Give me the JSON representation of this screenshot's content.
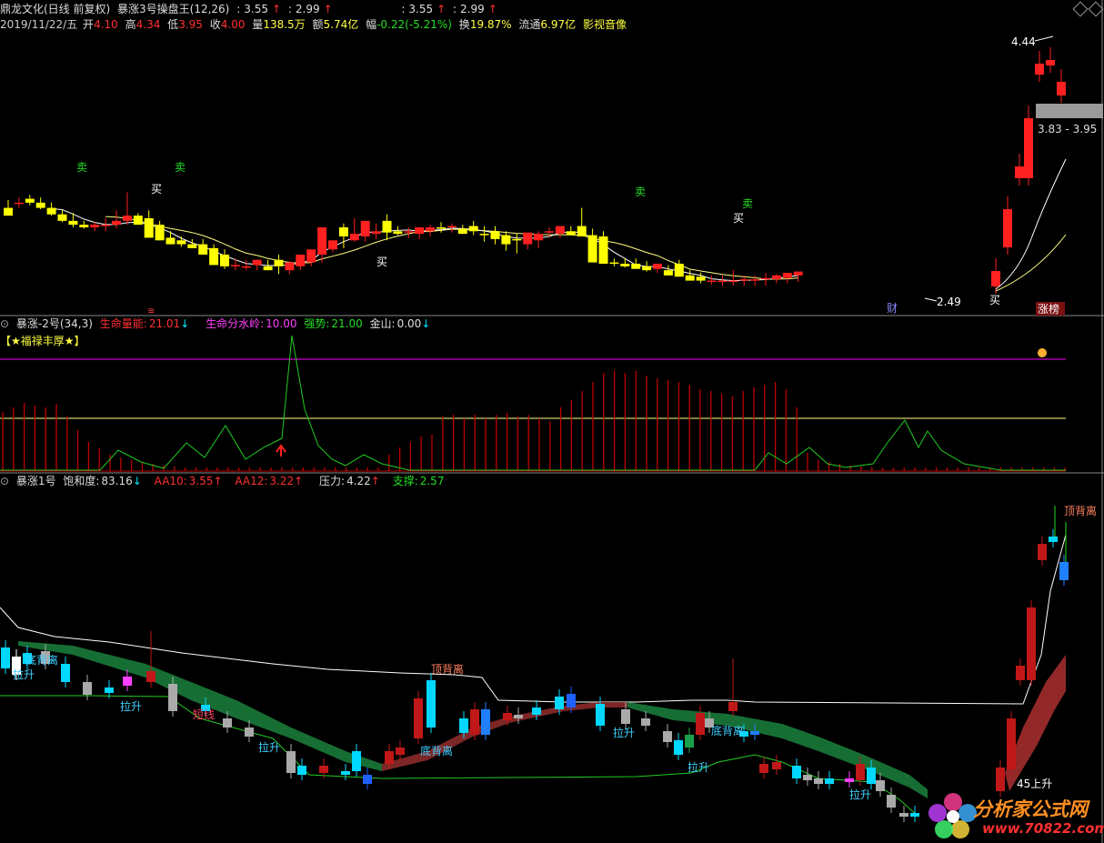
{
  "title": {
    "stock_name": "鼎龙文化(日线 前复权)",
    "indicator": "暴涨3号操盘王(12,26)",
    "val1": "3.55",
    "val2": "2.99",
    "val3": "3.55",
    "val4": "2.99"
  },
  "quote": {
    "date": "2019/11/22/五",
    "open_label": "开",
    "open": "4.10",
    "high_label": "高",
    "high": "4.34",
    "low_label": "低",
    "low": "3.95",
    "close_label": "收",
    "close": "4.00",
    "vol_label": "量",
    "vol": "138.5万",
    "amount_label": "额",
    "amount": "5.74亿",
    "change_label": "幅",
    "change": "-0.22(-5.21%)",
    "turnover_label": "换",
    "turnover": "19.87%",
    "float_label": "流通",
    "float": "6.97亿",
    "sector": "影视音像"
  },
  "panel2_header": {
    "name": "暴涨-2号(34,3)",
    "l1": "生命量能:",
    "v1": "21.01",
    "l2": "生命分水岭:",
    "v2": "10.00",
    "l3": "强势:",
    "v3": "21.00",
    "l4": "金山:",
    "v4": "0.00",
    "banner": "【★福禄丰厚★】"
  },
  "panel3_header": {
    "name": "暴涨1号",
    "l1": "饱和度:",
    "v1": "83.16",
    "l2": "AA10:",
    "v2": "3.55",
    "l3": "AA12:",
    "v3": "3.22",
    "l4": "压力:",
    "v4": "4.22",
    "l5": "支撑:",
    "v5": "2.57"
  },
  "annotations": {
    "high_price": "4.44",
    "low_price": "2.49",
    "range_box": "3.83 - 3.95",
    "tag_finance": "财",
    "tag_limit": "涨榜",
    "buy": "买",
    "sell": "卖",
    "lashen": "拉升",
    "top_div": "顶背离",
    "bottom_div": "底背离",
    "short_term": "短线",
    "up45": "45上升"
  },
  "watermark": {
    "cn": "分析家公式网",
    "url": "www.70822.com"
  },
  "colors": {
    "up": "#ff2020",
    "down_yellow": "#ffff00",
    "ma_white": "#ffffff",
    "ma_yellow": "#ffff80",
    "volume_red": "#c00000",
    "green_line": "#22cc22",
    "magenta": "#ff00ff",
    "cyan": "#00e5ff"
  },
  "chart_data": {
    "type": "candlestick",
    "x": [
      0,
      1,
      2,
      3,
      4,
      5,
      6,
      7,
      8,
      9,
      10,
      11,
      12,
      13,
      14,
      15,
      16,
      17,
      18,
      19,
      20,
      21,
      22,
      23,
      24,
      25,
      26,
      27,
      28,
      29,
      30,
      31,
      32,
      33,
      34,
      35,
      36,
      37,
      38,
      39,
      40,
      41,
      42,
      43,
      44,
      45,
      46,
      47,
      48,
      49,
      50,
      51,
      52,
      53,
      54,
      55,
      56,
      57,
      58,
      59,
      60,
      61,
      62,
      63,
      64,
      65,
      66,
      67,
      68,
      69,
      70,
      71,
      72,
      73,
      74,
      75,
      76,
      77,
      78,
      79,
      80,
      81,
      82,
      83,
      84,
      85,
      86,
      87,
      88,
      89,
      90,
      91,
      92,
      93,
      94,
      95,
      96,
      97
    ],
    "open": [
      3.18,
      3.22,
      3.25,
      3.22,
      3.18,
      3.13,
      3.08,
      3.05,
      3.03,
      3.05,
      3.05,
      3.08,
      3.12,
      3.1,
      3.05,
      2.95,
      2.93,
      2.9,
      2.9,
      2.87,
      2.82,
      2.74,
      2.73,
      2.74,
      2.73,
      2.78,
      2.7,
      2.73,
      2.76,
      2.82,
      2.86,
      3.03,
      2.93,
      2.96,
      2.98,
      3.08,
      3.0,
      2.99,
      2.98,
      3.0,
      3.03,
      3.03,
      3.02,
      3.04,
      2.98,
      3.0,
      2.97,
      2.94,
      2.9,
      2.93,
      2.99,
      2.98,
      3.0,
      3.04,
      2.97,
      2.96,
      2.76,
      2.75,
      2.75,
      2.73,
      2.71,
      2.7,
      2.75,
      2.66,
      2.65,
      2.62,
      2.62,
      2.62,
      2.62,
      2.62,
      2.63,
      2.63,
      2.64,
      2.66
    ],
    "high": [
      3.24,
      3.26,
      3.28,
      3.26,
      3.22,
      3.16,
      3.14,
      3.08,
      3.07,
      3.1,
      3.16,
      3.3,
      3.14,
      3.16,
      3.08,
      3.0,
      2.96,
      2.94,
      2.94,
      2.9,
      2.86,
      2.79,
      2.78,
      2.78,
      2.78,
      2.82,
      2.77,
      2.77,
      2.82,
      2.88,
      2.92,
      3.06,
      3.1,
      3.02,
      3.06,
      3.13,
      3.04,
      3.03,
      3.02,
      3.05,
      3.07,
      3.06,
      3.05,
      3.08,
      3.04,
      3.04,
      3.0,
      2.98,
      2.96,
      3.0,
      3.03,
      3.03,
      3.04,
      3.18,
      3.02,
      3.0,
      2.79,
      2.79,
      2.79,
      2.77,
      2.75,
      2.74,
      2.78,
      2.7,
      2.68,
      2.66,
      2.66,
      2.7,
      2.66,
      2.66,
      2.68,
      2.67,
      2.67,
      2.69
    ],
    "low": [
      3.12,
      3.18,
      3.2,
      3.17,
      3.12,
      3.07,
      3.03,
      3.02,
      3.0,
      3.0,
      3.02,
      3.05,
      3.07,
      3.02,
      2.93,
      2.9,
      2.88,
      2.87,
      2.85,
      2.8,
      2.71,
      2.7,
      2.7,
      2.7,
      2.7,
      2.67,
      2.67,
      2.7,
      2.73,
      2.76,
      2.84,
      2.87,
      2.92,
      2.92,
      2.94,
      2.93,
      2.97,
      2.95,
      2.94,
      2.96,
      2.99,
      2.99,
      2.98,
      2.97,
      2.92,
      2.9,
      2.85,
      2.83,
      2.86,
      2.87,
      2.95,
      2.95,
      2.97,
      2.96,
      2.93,
      2.8,
      2.73,
      2.72,
      2.72,
      2.69,
      2.68,
      2.66,
      2.66,
      2.62,
      2.6,
      2.59,
      2.58,
      2.58,
      2.58,
      2.58,
      2.58,
      2.6,
      2.6,
      2.61
    ],
    "close": [
      3.12,
      3.22,
      3.22,
      3.18,
      3.13,
      3.08,
      3.05,
      3.03,
      3.05,
      3.05,
      3.08,
      3.12,
      3.05,
      2.95,
      2.93,
      2.9,
      2.9,
      2.87,
      2.82,
      2.74,
      2.73,
      2.74,
      2.73,
      2.78,
      2.7,
      2.73,
      2.76,
      2.82,
      2.86,
      3.03,
      2.93,
      2.96,
      2.98,
      3.08,
      3.0,
      2.99,
      2.98,
      3.0,
      3.03,
      3.03,
      3.02,
      3.04,
      2.98,
      3.0,
      2.97,
      2.94,
      2.9,
      2.93,
      2.99,
      2.98,
      3.0,
      3.04,
      2.97,
      2.96,
      2.76,
      2.75,
      2.75,
      2.73,
      2.71,
      2.7,
      2.75,
      2.66,
      2.65,
      2.62,
      2.62,
      2.62,
      2.62,
      2.62,
      2.63,
      2.63,
      2.64,
      2.66,
      2.68,
      2.69
    ],
    "ylim": [
      2.4,
      4.5
    ],
    "xlabel": "",
    "ylabel": ""
  }
}
